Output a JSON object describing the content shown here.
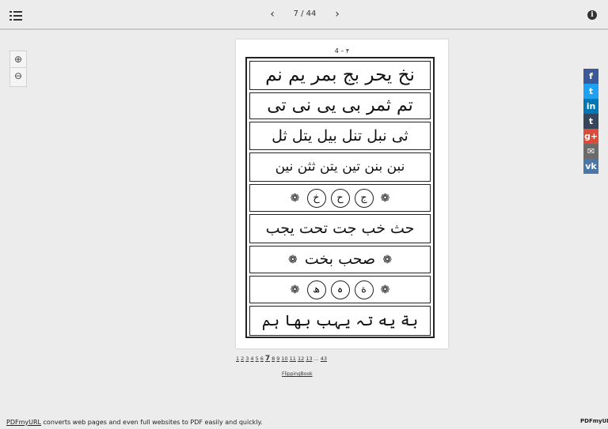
{
  "toolbar": {
    "menu_icon": "list-menu-icon",
    "prev_label": "‹",
    "page_counter": "7 / 44",
    "next_label": "›",
    "info_label": "i"
  },
  "zoom": {
    "zoom_in_label": "⊕",
    "zoom_out_label": "⊖"
  },
  "page": {
    "page_number": "4 – ۴",
    "rows": [
      "نخ يحر بج بمر يم نم",
      "تم ثمر بی يی نی تی",
      "ثی نبل تنل بيل يتل ثل",
      "نبن بنن تين يتن ثثن نين",
      "",
      "حث خب جت تحت يجب",
      "صحب بخت",
      "",
      "بة يه تہ يہب بها ہم"
    ],
    "circles_row_5": [
      "ج",
      "ح",
      "خ"
    ],
    "circles_row_8": [
      "ة",
      "ہ",
      "ھ"
    ]
  },
  "share": [
    {
      "label": "f",
      "color": "#3b5998",
      "icon": "facebook-icon"
    },
    {
      "label": "t",
      "color": "#1da1f2",
      "icon": "twitter-icon"
    },
    {
      "label": "in",
      "color": "#0077b5",
      "icon": "linkedin-icon"
    },
    {
      "label": "t",
      "color": "#35465c",
      "icon": "tumblr-icon"
    },
    {
      "label": "g+",
      "color": "#dd4b39",
      "icon": "google-plus-icon"
    },
    {
      "label": "✉",
      "color": "#6b6b6b",
      "icon": "email-icon"
    },
    {
      "label": "vk",
      "color": "#4a76a8",
      "icon": "vk-icon"
    }
  ],
  "pagination": {
    "pages": [
      "1",
      "2",
      "3",
      "4",
      "5",
      "6",
      "7",
      "8",
      "9",
      "10",
      "11",
      "12",
      "13"
    ],
    "current": "7",
    "ellipsis": "...",
    "last": "43"
  },
  "flippingbook_label": "FlippingBook",
  "footer": {
    "link_text": "PDFmyURL",
    "text": " converts web pages and even full websites to PDF easily and quickly."
  },
  "logo_text": "PDFmyURL"
}
